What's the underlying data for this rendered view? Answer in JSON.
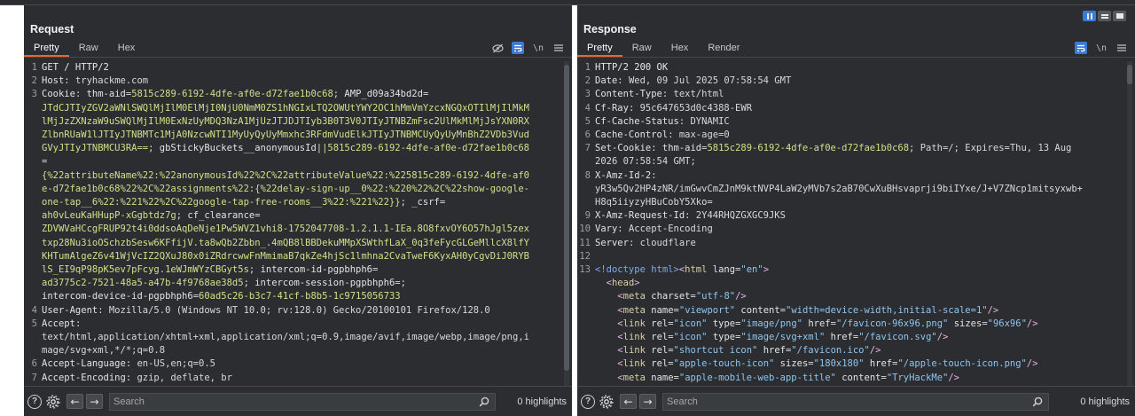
{
  "request": {
    "title": "Request",
    "tabs": [
      "Pretty",
      "Raw",
      "Hex"
    ],
    "active_tab": "Pretty",
    "tool_icons": [
      "hide-nonprintable-icon",
      "wrap-lines-icon",
      "newline-icon",
      "menu-icon"
    ],
    "lines": [
      {
        "num": "1",
        "segs": [
          {
            "t": "GET / HTTP/2",
            "c": "k"
          }
        ]
      },
      {
        "num": "2",
        "segs": [
          {
            "t": "Host",
            "c": "h"
          },
          {
            "t": ": tryhackme.com",
            "c": "v"
          }
        ]
      },
      {
        "num": "3",
        "segs": [
          {
            "t": "Cookie",
            "c": "h"
          },
          {
            "t": ": ",
            "c": "v"
          },
          {
            "t": "thm-aid",
            "c": "h"
          },
          {
            "t": "=",
            "c": "v"
          },
          {
            "t": "5815c289-6192-4dfe-af0e-d72fae1b0c68",
            "c": "g"
          },
          {
            "t": "; ",
            "c": "v"
          },
          {
            "t": "AMP_d09a34bd2d",
            "c": "h"
          },
          {
            "t": "=",
            "c": "v"
          }
        ]
      },
      {
        "num": "",
        "segs": [
          {
            "t": "JTdCJTIyZGV2aWNlSWQlMjIlM0ElMjI0NjU0NmM0ZS1hNGIxLTQ2OWUtYWY2OC1hMmVmYzcxNGQxOTIlMjIlMkM",
            "c": "g"
          }
        ]
      },
      {
        "num": "",
        "segs": [
          {
            "t": "lMjJzZXNzaW9uSWQlMjIlM0ExNzUyMDQ3NzA1MjUzJTJDJTIyb3B0T3V0JTIyJTNBZmFsc2UlMkMlMjJsYXN0RX",
            "c": "g"
          }
        ]
      },
      {
        "num": "",
        "segs": [
          {
            "t": "ZlbnRUaW1lJTIyJTNBMTc1MjA0NzcwNTI1MyUyQyUyMmxhc3RFdmVudElkJTIyJTNBMCUyQyUyMnBhZ2VDb3Vud",
            "c": "g"
          }
        ]
      },
      {
        "num": "",
        "segs": [
          {
            "t": "GVyJTIyJTNBMCU3RA==",
            "c": "g"
          },
          {
            "t": "; ",
            "c": "v"
          },
          {
            "t": "gbStickyBuckets__anonymousId",
            "c": "h"
          },
          {
            "t": "|",
            "c": "v"
          },
          {
            "t": "|5815c289-6192-4dfe-af0e-d72fae1b0c68",
            "c": "g"
          }
        ]
      },
      {
        "num": "",
        "segs": [
          {
            "t": "=",
            "c": "v"
          }
        ]
      },
      {
        "num": "",
        "segs": [
          {
            "t": "{%22attributeName%22:%22anonymousId%22%2C%22attributeValue%22:%225815c289-6192-4dfe-af0",
            "c": "g"
          }
        ]
      },
      {
        "num": "",
        "segs": [
          {
            "t": "e-d72fae1b0c68%22%2C%22assignments%22:{%22delay-sign-up__0%22:%220%22%2C%22show-google-",
            "c": "g"
          }
        ]
      },
      {
        "num": "",
        "segs": [
          {
            "t": "one-tap__6%22:%221%22%2C%22google-tap-free-rooms__3%22:%221%22}}",
            "c": "g"
          },
          {
            "t": "; ",
            "c": "v"
          },
          {
            "t": "_csrf",
            "c": "h"
          },
          {
            "t": "=",
            "c": "v"
          }
        ]
      },
      {
        "num": "",
        "segs": [
          {
            "t": "ah0vLeuKaHHupP-xGgbtdz7g",
            "c": "g"
          },
          {
            "t": "; ",
            "c": "v"
          },
          {
            "t": "cf_clearance",
            "c": "h"
          },
          {
            "t": "=",
            "c": "v"
          }
        ]
      },
      {
        "num": "",
        "segs": [
          {
            "t": "ZDVWVaHCcgFRUP92t4i0ddsoAqDeNje1Pw5WVZ1vhi8-1752047708-1.2.1.1-IEa.8O8fxvOY6O57hJgl5zex",
            "c": "g"
          }
        ]
      },
      {
        "num": "",
        "segs": [
          {
            "t": "txp28Nu3ioOSchzbSesw6KFfijV.ta8wQb2Zbbn_.4mQB8lBBDekuMMpXSWthfLaX_0q3feFycGLGeMllcX8lfY",
            "c": "g"
          }
        ]
      },
      {
        "num": "",
        "segs": [
          {
            "t": "KHTumAlgeZ6v41WjVcIZ2QXuJ80x0iZRdrcwwFnMmimaB7qkZe4hjSc1lmhna2CvaTweF6KyxAH0yCgvDiJ0RYB",
            "c": "g"
          }
        ]
      },
      {
        "num": "",
        "segs": [
          {
            "t": "lS_EI9qP98pK5ev7pFcyg.1eWJmWYzCBGyt5s",
            "c": "g"
          },
          {
            "t": "; ",
            "c": "v"
          },
          {
            "t": "intercom-id-pgpbhph6",
            "c": "h"
          },
          {
            "t": "=",
            "c": "v"
          }
        ]
      },
      {
        "num": "",
        "segs": [
          {
            "t": "ad3775c2-7521-48a5-a47b-4f9768ae38d5",
            "c": "g"
          },
          {
            "t": "; ",
            "c": "v"
          },
          {
            "t": "intercom-session-pgpbhph6",
            "c": "h"
          },
          {
            "t": "=;",
            "c": "v"
          }
        ]
      },
      {
        "num": "",
        "segs": [
          {
            "t": "intercom-device-id-pgpbhph6",
            "c": "h"
          },
          {
            "t": "=",
            "c": "v"
          },
          {
            "t": "60ad5c26-b3c7-41cf-b8b5-1c9715056733",
            "c": "g"
          }
        ]
      },
      {
        "num": "4",
        "segs": [
          {
            "t": "User-Agent",
            "c": "h"
          },
          {
            "t": ": Mozilla/5.0 (Windows NT 10.0; rv:128.0) Gecko/20100101 Firefox/128.0",
            "c": "v"
          }
        ]
      },
      {
        "num": "5",
        "segs": [
          {
            "t": "Accept",
            "c": "h"
          },
          {
            "t": ":",
            "c": "v"
          }
        ]
      },
      {
        "num": "",
        "segs": [
          {
            "t": "text/html,application/xhtml+xml,application/xml;q=0.9,image/avif,image/webp,image/png,i",
            "c": "v"
          }
        ]
      },
      {
        "num": "",
        "segs": [
          {
            "t": "mage/svg+xml,*/*;q=0.8",
            "c": "v"
          }
        ]
      },
      {
        "num": "6",
        "segs": [
          {
            "t": "Accept-Language",
            "c": "h"
          },
          {
            "t": ": en-US,en;q=0.5",
            "c": "v"
          }
        ]
      },
      {
        "num": "7",
        "segs": [
          {
            "t": "Accept-Encoding",
            "c": "h"
          },
          {
            "t": ": gzip, deflate, br",
            "c": "v"
          }
        ]
      }
    ],
    "search_placeholder": "Search",
    "highlights": "0 highlights"
  },
  "response": {
    "title": "Response",
    "tabs": [
      "Pretty",
      "Raw",
      "Hex",
      "Render"
    ],
    "active_tab": "Pretty",
    "tool_icons": [
      "wrap-lines-icon",
      "newline-icon",
      "menu-icon"
    ],
    "lines": [
      {
        "num": "1",
        "segs": [
          {
            "t": "HTTP/2 200 OK",
            "c": "k"
          }
        ]
      },
      {
        "num": "2",
        "segs": [
          {
            "t": "Date",
            "c": "h"
          },
          {
            "t": ": Wed, 09 Jul 2025 07:58:54 GMT",
            "c": "v"
          }
        ]
      },
      {
        "num": "3",
        "segs": [
          {
            "t": "Content-Type",
            "c": "h"
          },
          {
            "t": ": text/html",
            "c": "v"
          }
        ]
      },
      {
        "num": "4",
        "segs": [
          {
            "t": "Cf-Ray",
            "c": "h"
          },
          {
            "t": ": 95c647653d0c4388-EWR",
            "c": "v"
          }
        ]
      },
      {
        "num": "5",
        "segs": [
          {
            "t": "Cf-Cache-Status",
            "c": "h"
          },
          {
            "t": ": DYNAMIC",
            "c": "v"
          }
        ]
      },
      {
        "num": "6",
        "segs": [
          {
            "t": "Cache-Control",
            "c": "h"
          },
          {
            "t": ": max-age=0",
            "c": "v"
          }
        ]
      },
      {
        "num": "7",
        "segs": [
          {
            "t": "Set-Cookie",
            "c": "h"
          },
          {
            "t": ": ",
            "c": "v"
          },
          {
            "t": "thm-aid",
            "c": "h"
          },
          {
            "t": "=",
            "c": "v"
          },
          {
            "t": "5815c289-6192-4dfe-af0e-d72fae1b0c68",
            "c": "g"
          },
          {
            "t": "; Path=/; Expires=Thu, 13 Aug",
            "c": "v"
          }
        ]
      },
      {
        "num": "",
        "segs": [
          {
            "t": "2026 07:58:54 GMT;",
            "c": "v"
          }
        ]
      },
      {
        "num": "8",
        "segs": [
          {
            "t": "X-Amz-Id-2",
            "c": "h"
          },
          {
            "t": ":",
            "c": "v"
          }
        ]
      },
      {
        "num": "",
        "segs": [
          {
            "t": "yR3w5Qv2HP4zNR/imGwvCmZJnM9ktNVP4LaW2yMVb7s2aB70CwXuBHsvaprji9biIYxe/J+V7ZNcp1mitsyxwb+",
            "c": "v"
          }
        ]
      },
      {
        "num": "",
        "segs": [
          {
            "t": "H8q5iiyzyHBuCobY5Xko=",
            "c": "v"
          }
        ]
      },
      {
        "num": "9",
        "segs": [
          {
            "t": "X-Amz-Request-Id",
            "c": "h"
          },
          {
            "t": ": 2Y44RHQZGXGC9JKS",
            "c": "v"
          }
        ]
      },
      {
        "num": "10",
        "segs": [
          {
            "t": "Vary",
            "c": "h"
          },
          {
            "t": ": Accept-Encoding",
            "c": "v"
          }
        ]
      },
      {
        "num": "11",
        "segs": [
          {
            "t": "Server",
            "c": "h"
          },
          {
            "t": ": cloudflare",
            "c": "v"
          }
        ]
      },
      {
        "num": "12",
        "segs": []
      },
      {
        "num": "13",
        "segs": [
          {
            "t": "<!doctype html>",
            "c": "pk"
          },
          {
            "t": "<",
            "c": "br"
          },
          {
            "t": "html",
            "c": "tg"
          },
          {
            "t": " ",
            "c": "sep"
          },
          {
            "t": "lang",
            "c": "an"
          },
          {
            "t": "=",
            "c": "sep"
          },
          {
            "t": "\"en\"",
            "c": "av"
          },
          {
            "t": ">",
            "c": "br"
          }
        ]
      },
      {
        "num": "",
        "segs": [
          {
            "t": "  ",
            "c": "sep"
          },
          {
            "t": "<",
            "c": "br"
          },
          {
            "t": "head",
            "c": "tg"
          },
          {
            "t": ">",
            "c": "br"
          }
        ]
      },
      {
        "num": "",
        "segs": [
          {
            "t": "    ",
            "c": "sep"
          },
          {
            "t": "<",
            "c": "br"
          },
          {
            "t": "meta",
            "c": "tg"
          },
          {
            "t": " ",
            "c": "sep"
          },
          {
            "t": "charset",
            "c": "an"
          },
          {
            "t": "=",
            "c": "sep"
          },
          {
            "t": "\"utf-8\"",
            "c": "av"
          },
          {
            "t": "/>",
            "c": "br"
          }
        ]
      },
      {
        "num": "",
        "segs": [
          {
            "t": "    ",
            "c": "sep"
          },
          {
            "t": "<",
            "c": "br"
          },
          {
            "t": "meta",
            "c": "tg"
          },
          {
            "t": " ",
            "c": "sep"
          },
          {
            "t": "name",
            "c": "an"
          },
          {
            "t": "=",
            "c": "sep"
          },
          {
            "t": "\"viewport\"",
            "c": "av"
          },
          {
            "t": " ",
            "c": "sep"
          },
          {
            "t": "content",
            "c": "an"
          },
          {
            "t": "=",
            "c": "sep"
          },
          {
            "t": "\"width=device-width,initial-scale=1\"",
            "c": "av"
          },
          {
            "t": "/>",
            "c": "br"
          }
        ]
      },
      {
        "num": "",
        "segs": [
          {
            "t": "    ",
            "c": "sep"
          },
          {
            "t": "<",
            "c": "br"
          },
          {
            "t": "link",
            "c": "tg"
          },
          {
            "t": " ",
            "c": "sep"
          },
          {
            "t": "rel",
            "c": "an"
          },
          {
            "t": "=",
            "c": "sep"
          },
          {
            "t": "\"icon\"",
            "c": "av"
          },
          {
            "t": " ",
            "c": "sep"
          },
          {
            "t": "type",
            "c": "an"
          },
          {
            "t": "=",
            "c": "sep"
          },
          {
            "t": "\"image/png\"",
            "c": "av"
          },
          {
            "t": " ",
            "c": "sep"
          },
          {
            "t": "href",
            "c": "an"
          },
          {
            "t": "=",
            "c": "sep"
          },
          {
            "t": "\"/favicon-96x96.png\"",
            "c": "av"
          },
          {
            "t": " ",
            "c": "sep"
          },
          {
            "t": "sizes",
            "c": "an"
          },
          {
            "t": "=",
            "c": "sep"
          },
          {
            "t": "\"96x96\"",
            "c": "av"
          },
          {
            "t": "/>",
            "c": "br"
          }
        ]
      },
      {
        "num": "",
        "segs": [
          {
            "t": "    ",
            "c": "sep"
          },
          {
            "t": "<",
            "c": "br"
          },
          {
            "t": "link",
            "c": "tg"
          },
          {
            "t": " ",
            "c": "sep"
          },
          {
            "t": "rel",
            "c": "an"
          },
          {
            "t": "=",
            "c": "sep"
          },
          {
            "t": "\"icon\"",
            "c": "av"
          },
          {
            "t": " ",
            "c": "sep"
          },
          {
            "t": "type",
            "c": "an"
          },
          {
            "t": "=",
            "c": "sep"
          },
          {
            "t": "\"image/svg+xml\"",
            "c": "av"
          },
          {
            "t": " ",
            "c": "sep"
          },
          {
            "t": "href",
            "c": "an"
          },
          {
            "t": "=",
            "c": "sep"
          },
          {
            "t": "\"/favicon.svg\"",
            "c": "av"
          },
          {
            "t": "/>",
            "c": "br"
          }
        ]
      },
      {
        "num": "",
        "segs": [
          {
            "t": "    ",
            "c": "sep"
          },
          {
            "t": "<",
            "c": "br"
          },
          {
            "t": "link",
            "c": "tg"
          },
          {
            "t": " ",
            "c": "sep"
          },
          {
            "t": "rel",
            "c": "an"
          },
          {
            "t": "=",
            "c": "sep"
          },
          {
            "t": "\"shortcut icon\"",
            "c": "av"
          },
          {
            "t": " ",
            "c": "sep"
          },
          {
            "t": "href",
            "c": "an"
          },
          {
            "t": "=",
            "c": "sep"
          },
          {
            "t": "\"/favicon.ico\"",
            "c": "av"
          },
          {
            "t": "/>",
            "c": "br"
          }
        ]
      },
      {
        "num": "",
        "segs": [
          {
            "t": "    ",
            "c": "sep"
          },
          {
            "t": "<",
            "c": "br"
          },
          {
            "t": "link",
            "c": "tg"
          },
          {
            "t": " ",
            "c": "sep"
          },
          {
            "t": "rel",
            "c": "an"
          },
          {
            "t": "=",
            "c": "sep"
          },
          {
            "t": "\"apple-touch-icon\"",
            "c": "av"
          },
          {
            "t": " ",
            "c": "sep"
          },
          {
            "t": "sizes",
            "c": "an"
          },
          {
            "t": "=",
            "c": "sep"
          },
          {
            "t": "\"180x180\"",
            "c": "av"
          },
          {
            "t": " ",
            "c": "sep"
          },
          {
            "t": "href",
            "c": "an"
          },
          {
            "t": "=",
            "c": "sep"
          },
          {
            "t": "\"/apple-touch-icon.png\"",
            "c": "av"
          },
          {
            "t": "/>",
            "c": "br"
          }
        ]
      },
      {
        "num": "",
        "segs": [
          {
            "t": "    ",
            "c": "sep"
          },
          {
            "t": "<",
            "c": "br"
          },
          {
            "t": "meta",
            "c": "tg"
          },
          {
            "t": " ",
            "c": "sep"
          },
          {
            "t": "name",
            "c": "an"
          },
          {
            "t": "=",
            "c": "sep"
          },
          {
            "t": "\"apple-mobile-web-app-title\"",
            "c": "av"
          },
          {
            "t": " ",
            "c": "sep"
          },
          {
            "t": "content",
            "c": "an"
          },
          {
            "t": "=",
            "c": "sep"
          },
          {
            "t": "\"TryHackMe\"",
            "c": "av"
          },
          {
            "t": "/>",
            "c": "br"
          }
        ]
      }
    ],
    "search_placeholder": "Search",
    "highlights": "0 highlights"
  },
  "colors": {
    "panel_bg": "#2b2d30",
    "accent_tab": "#e36a2e",
    "accent_blue": "#3a7bd5",
    "cookie_value_green": "#cfe08a"
  }
}
